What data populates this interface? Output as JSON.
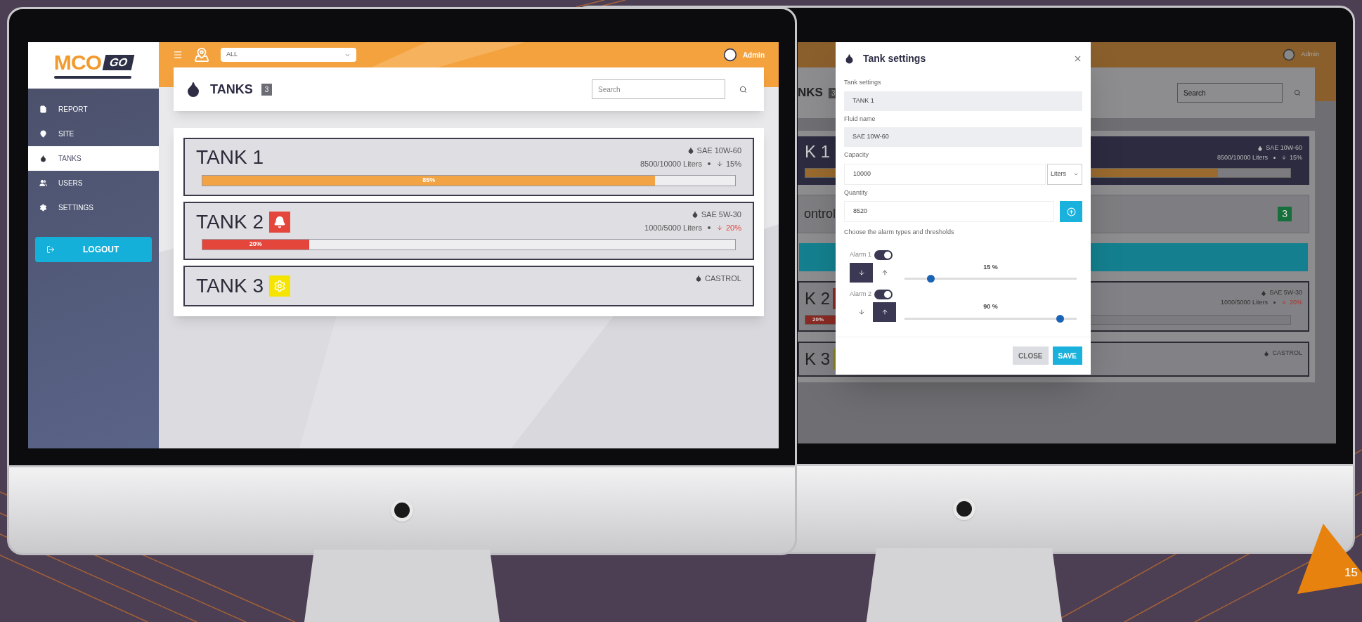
{
  "left_screen": {
    "logo": {
      "text": "MCO",
      "badge": "GO"
    },
    "sidebar": {
      "items": [
        {
          "label": "REPORT",
          "kind": "report",
          "selected": false
        },
        {
          "label": "SITE",
          "kind": "site",
          "selected": false
        },
        {
          "label": "TANKS",
          "kind": "tanks",
          "selected": true
        },
        {
          "label": "USERS",
          "kind": "users",
          "selected": false
        },
        {
          "label": "SETTINGS",
          "kind": "settings",
          "selected": false
        }
      ],
      "logout": "LOGOUT"
    },
    "topbar": {
      "site_filter": "ALL",
      "user": "Admin"
    },
    "header": {
      "title": "TANKS",
      "count": "3",
      "search": {
        "placeholder": "Search"
      }
    },
    "tanks": [
      {
        "name": "TANK 1",
        "fluid": "SAE 10W-60",
        "volume": "8500/10000 Liters",
        "change": "15%",
        "change_alert": false,
        "level": 0.85,
        "bar_label": "85%",
        "color": "#f2a444"
      },
      {
        "name": "TANK 2",
        "alert": {
          "kind": "alarm"
        },
        "fluid": "SAE 5W-30",
        "volume": "1000/5000 Liters",
        "change": "20%",
        "change_alert": true,
        "level": 0.2,
        "bar_label": "20%",
        "color": "#e5463b"
      },
      {
        "name": "TANK 3",
        "alert": {
          "kind": "maintenance"
        },
        "fluid": "CASTROL"
      }
    ]
  },
  "right_screen": {
    "topbar": {
      "user": "Admin"
    },
    "header": {
      "title": "NKS",
      "count": "3",
      "search": {
        "placeholder": "Search"
      }
    },
    "rows": [
      {
        "kind": "tank",
        "name": "K 1",
        "highlighted": true,
        "fluid": "SAE 10W-60",
        "volume": "8500/10000 Liters",
        "change": "15%",
        "change_alert": false,
        "level": 0.85,
        "color": "#9a6a2e"
      },
      {
        "kind": "group",
        "name": "ontrol",
        "count": "3"
      },
      {
        "kind": "bar"
      },
      {
        "kind": "tank",
        "name": "K 2",
        "alert": {
          "kind": "alarm"
        },
        "highlighted": false,
        "fluid": "SAE 5W-30",
        "volume": "1000/5000 Liters",
        "change": "20%",
        "change_alert": true,
        "level": 0.2,
        "bar_label": "20%",
        "color": "#8a2a24"
      },
      {
        "kind": "tank",
        "name": "K 3",
        "alert": {
          "kind": "maintenance"
        },
        "highlighted": false,
        "fluid": "CASTROL"
      }
    ],
    "modal": {
      "title": "Tank settings",
      "fields": [
        {
          "kind": "readonly",
          "label": "Tank settings",
          "value": "TANK 1"
        },
        {
          "kind": "readonly",
          "label": "Fluid name",
          "value": "SAE 10W-60"
        },
        {
          "kind": "unit",
          "label": "Capacity",
          "value": "10000",
          "unit": "Liters"
        },
        {
          "kind": "action",
          "label": "Quantity",
          "value": "8520"
        }
      ],
      "alarm_intro": "Choose the alarm types and thresholds",
      "alarms": [
        {
          "label": "Alarm 1",
          "on": true,
          "directions": [
            {
              "kind": "down",
              "selected": true
            },
            {
              "kind": "up",
              "selected": false
            }
          ],
          "reading": "15 %",
          "level": 0.15
        },
        {
          "label": "Alarm 2",
          "on": true,
          "directions": [
            {
              "kind": "down",
              "selected": false
            },
            {
              "kind": "up",
              "selected": true
            }
          ],
          "reading": "90 %",
          "level": 0.9
        }
      ],
      "buttons": [
        {
          "label": "CLOSE",
          "kind": "secondary"
        },
        {
          "label": "SAVE",
          "kind": "primary"
        }
      ]
    }
  },
  "page_number": "15"
}
